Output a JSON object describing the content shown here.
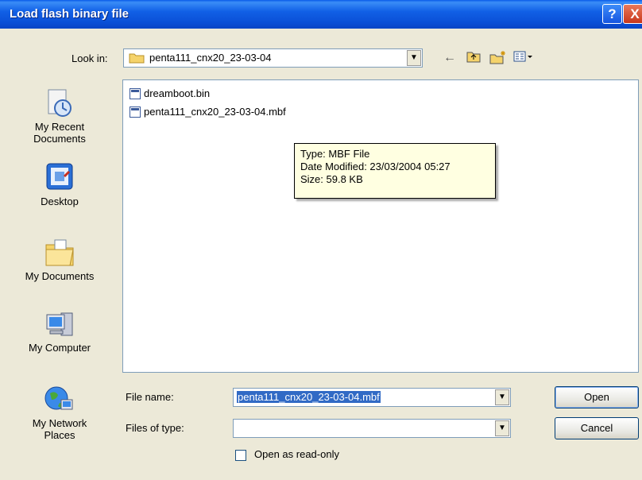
{
  "window": {
    "title": "Load flash binary file",
    "help_glyph": "?",
    "close_glyph": "X"
  },
  "lookin": {
    "label": "Look in:",
    "value": "penta111_cnx20_23-03-04"
  },
  "toolbar": {
    "back_glyph": "←",
    "up_glyph": "⌃",
    "newfolder_glyph": "✱",
    "views_glyph": "▦"
  },
  "places": [
    {
      "label": "My Recent\nDocuments"
    },
    {
      "label": "Desktop"
    },
    {
      "label": "My Documents"
    },
    {
      "label": "My Computer"
    },
    {
      "label": "My Network\nPlaces"
    }
  ],
  "files": [
    {
      "name": "dreamboot.bin"
    },
    {
      "name": "penta111_cnx20_23-03-04.mbf"
    }
  ],
  "tooltip": {
    "type": "Type: MBF File",
    "modified": "Date Modified: 23/03/2004 05:27",
    "size": "Size: 59.8 KB"
  },
  "form": {
    "filename_label": "File name:",
    "filename_value": "penta111_cnx20_23-03-04.mbf",
    "filetype_label": "Files of type:",
    "filetype_value": "",
    "readonly_label": "Open as read-only"
  },
  "buttons": {
    "open": "Open",
    "cancel": "Cancel"
  },
  "colors": {
    "titlebar": "#0a4fd6",
    "dialog_bg": "#ece9d8",
    "selection": "#316ac5",
    "tooltip_bg": "#ffffe1"
  }
}
